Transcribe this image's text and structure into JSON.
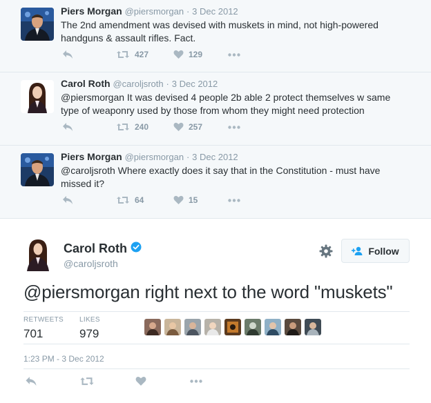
{
  "thread": [
    {
      "name": "Piers Morgan",
      "handle": "@piersmorgan",
      "dot": "·",
      "date": "3 Dec 2012",
      "text_line1": "The 2nd amendment was devised with muskets in mind, not high-powered",
      "text_line2": "handguns & assault rifles. Fact.",
      "retweets": "427",
      "likes": "129"
    },
    {
      "name": "Carol Roth",
      "handle": "@caroljsroth",
      "dot": "·",
      "date": "3 Dec 2012",
      "mention": "@piersmorgan",
      "text_line1": " It was devised 4 people 2b able 2 protect themselves w same",
      "text_line2": "type of weaponry used by those from whom they might need protection",
      "retweets": "240",
      "likes": "257"
    },
    {
      "name": "Piers Morgan",
      "handle": "@piersmorgan",
      "dot": "·",
      "date": "3 Dec 2012",
      "mention": "@caroljsroth",
      "text_line1": " Where exactly does it say that in the Constitution - must have",
      "text_line2": "missed it?",
      "retweets": "64",
      "likes": "15"
    }
  ],
  "main": {
    "name": "Carol Roth",
    "handle": "@caroljsroth",
    "follow_label": "Follow",
    "mention": "@piersmorgan",
    "text": " right next to the word \"muskets\"",
    "retweets_label": "RETWEETS",
    "retweets": "701",
    "likes_label": "LIKES",
    "likes": "979",
    "timestamp": "1:23 PM - 3 Dec 2012"
  },
  "colors": {
    "icon_gray": "#aab8c2",
    "verified": "#1da1f2",
    "follow_icon": "#1da1f2",
    "thread_bg": "#f5f8fa"
  },
  "icons": [
    "reply-icon",
    "retweet-icon",
    "heart-icon",
    "more-icon",
    "verified-icon",
    "gear-icon",
    "add-user-icon"
  ]
}
